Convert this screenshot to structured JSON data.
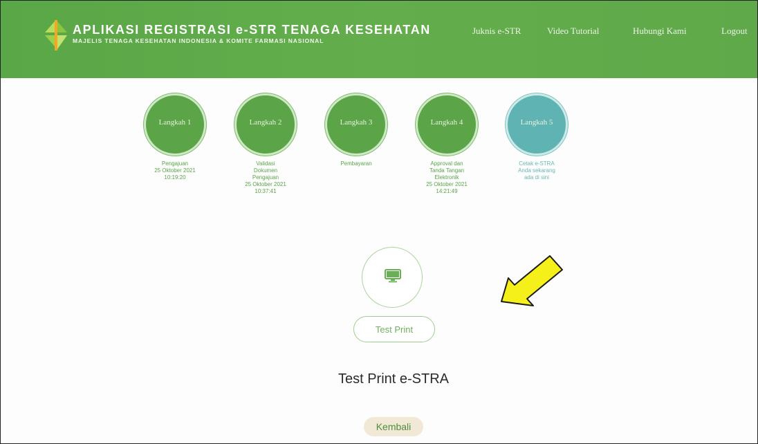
{
  "header": {
    "title": "APLIKASI REGISTRASI e-STR TENAGA KESEHATAN",
    "subtitle": "MAJELIS TENAGA KESEHATAN INDONESIA & KOMITE FARMASI NASIONAL",
    "nav": [
      "Juknis e-STR",
      "Video Tutorial",
      "Hubungi Kami",
      "Logout"
    ],
    "accent": "#5aa747"
  },
  "steps": [
    {
      "label": "Langkah 1",
      "lines": [
        "Pengajuan",
        "25 Oktober 2021",
        "10:19:20"
      ]
    },
    {
      "label": "Langkah 2",
      "lines": [
        "Validasi",
        "Dokumen",
        "Pengajuan",
        "25 Oktober 2021",
        "10:37:41"
      ]
    },
    {
      "label": "Langkah 3",
      "lines": [
        "Pembayaran"
      ]
    },
    {
      "label": "Langkah 4",
      "lines": [
        "Approval dan",
        "Tanda Tangan",
        "Elektronik",
        "25 Oktober 2021",
        "14:21:49"
      ]
    },
    {
      "label": "Langkah 5",
      "lines": [
        "Cetak e-STRA",
        "Anda sekarang",
        "ada di sini"
      ]
    }
  ],
  "main": {
    "icon": "monitor-icon",
    "test_print_label": "Test Print",
    "heading": "Test Print e-STRA",
    "back_label": "Kembali"
  },
  "annotation": {
    "icon": "arrow-icon",
    "color": "#f5ef1a"
  }
}
